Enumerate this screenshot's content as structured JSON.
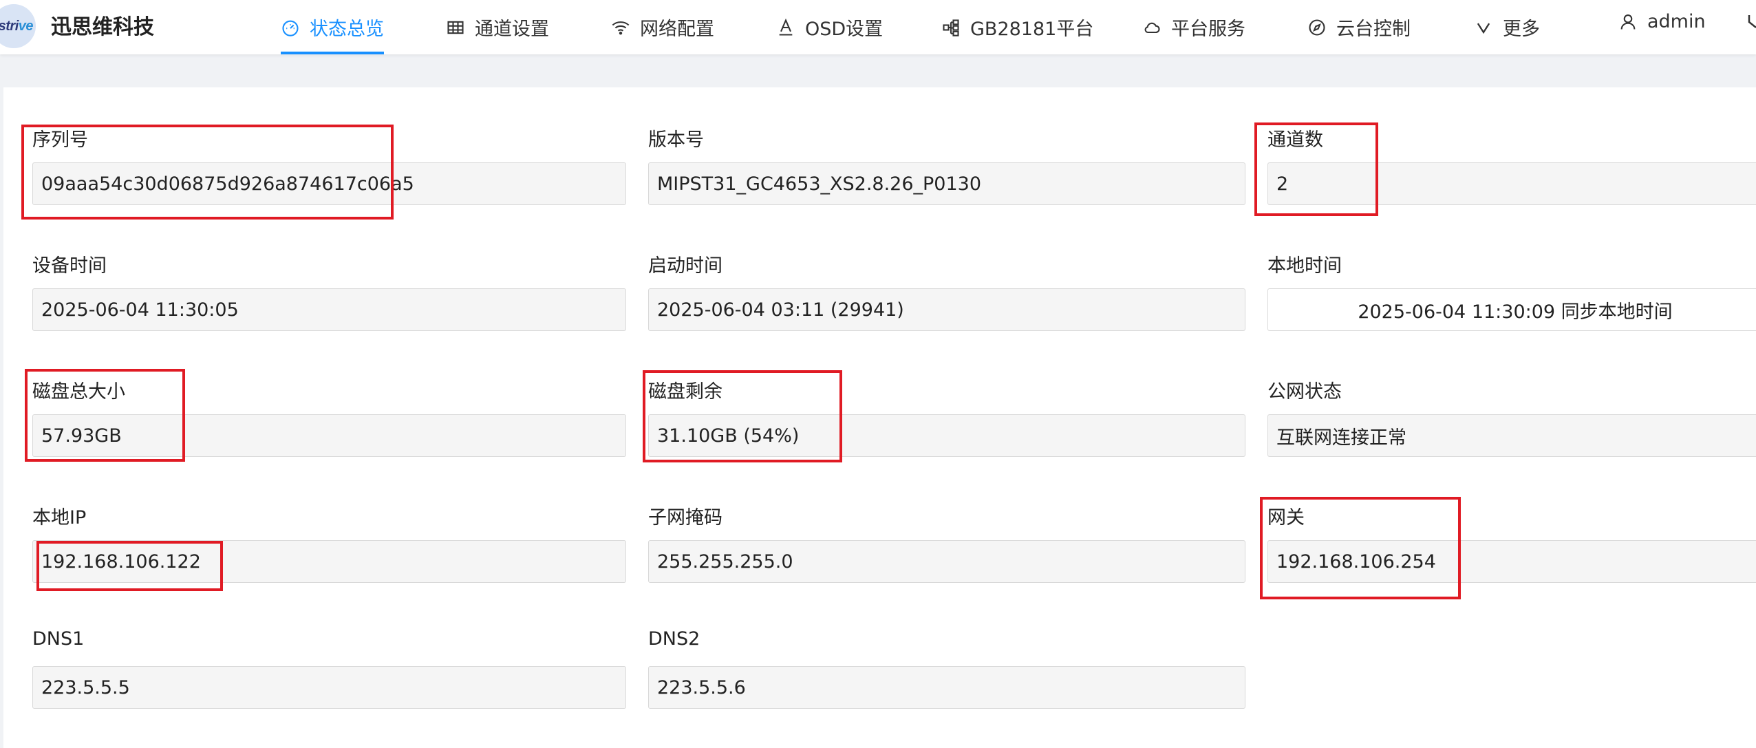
{
  "logo": {
    "text_main": "stri",
    "text_accent": "ve"
  },
  "brand": "迅思维科技",
  "nav": [
    {
      "label": "状态总览",
      "icon": "dashboard-icon",
      "active": true
    },
    {
      "label": "通道设置",
      "icon": "grid-icon",
      "active": false
    },
    {
      "label": "网络配置",
      "icon": "wifi-icon",
      "active": false
    },
    {
      "label": "OSD设置",
      "icon": "text-format-icon",
      "active": false
    },
    {
      "label": "GB28181平台",
      "icon": "cluster-icon",
      "active": false
    },
    {
      "label": "平台服务",
      "icon": "cloud-icon",
      "active": false
    },
    {
      "label": "云台控制",
      "icon": "compass-icon",
      "active": false
    },
    {
      "label": "更多",
      "icon": "chevron-down-icon",
      "active": false
    }
  ],
  "user": {
    "name": "admin",
    "icon": "user-icon"
  },
  "colors": {
    "accent": "#1890ff",
    "highlight": "#e01b24"
  },
  "fields": {
    "serial": {
      "label": "序列号",
      "value": "09aaa54c30d06875d926a874617c06a5"
    },
    "version": {
      "label": "版本号",
      "value": "MIPST31_GC4653_XS2.8.26_P0130"
    },
    "channels": {
      "label": "通道数",
      "value": "2"
    },
    "device_time": {
      "label": "设备时间",
      "value": "2025-06-04 11:30:05"
    },
    "boot_time": {
      "label": "启动时间",
      "value": "2025-06-04 03:11 (29941)"
    },
    "local_time": {
      "label": "本地时间",
      "value": "2025-06-04 11:30:09 同步本地时间"
    },
    "disk_total": {
      "label": "磁盘总大小",
      "value": "57.93GB"
    },
    "disk_free": {
      "label": "磁盘剩余",
      "value": "31.10GB (54%)"
    },
    "wan_status": {
      "label": "公网状态",
      "value": "互联网连接正常"
    },
    "local_ip": {
      "label": "本地IP",
      "value": "192.168.106.122"
    },
    "subnet_mask": {
      "label": "子网掩码",
      "value": "255.255.255.0"
    },
    "gateway": {
      "label": "网关",
      "value": "192.168.106.254"
    },
    "dns1": {
      "label": "DNS1",
      "value": "223.5.5.5"
    },
    "dns2": {
      "label": "DNS2",
      "value": "223.5.5.6"
    }
  }
}
